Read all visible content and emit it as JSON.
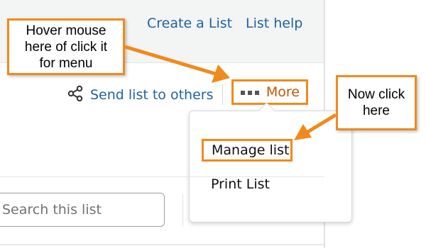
{
  "header": {
    "create_list": "Create a List",
    "list_help": "List help"
  },
  "actions": {
    "send_list": "Send list to others",
    "more": "More"
  },
  "menu": {
    "items": [
      "Manage list",
      "Print List"
    ]
  },
  "search": {
    "placeholder": "Search this list"
  },
  "annotations": {
    "hover_note": "Hover mouse\nhere of click it\nfor menu",
    "click_note": "Now click\nhere"
  },
  "colors": {
    "link": "#2162a1",
    "more": "#c45500",
    "annotation": "#f08a1c"
  },
  "icons": {
    "share": "share-icon",
    "dots": "more-dots-icon"
  }
}
